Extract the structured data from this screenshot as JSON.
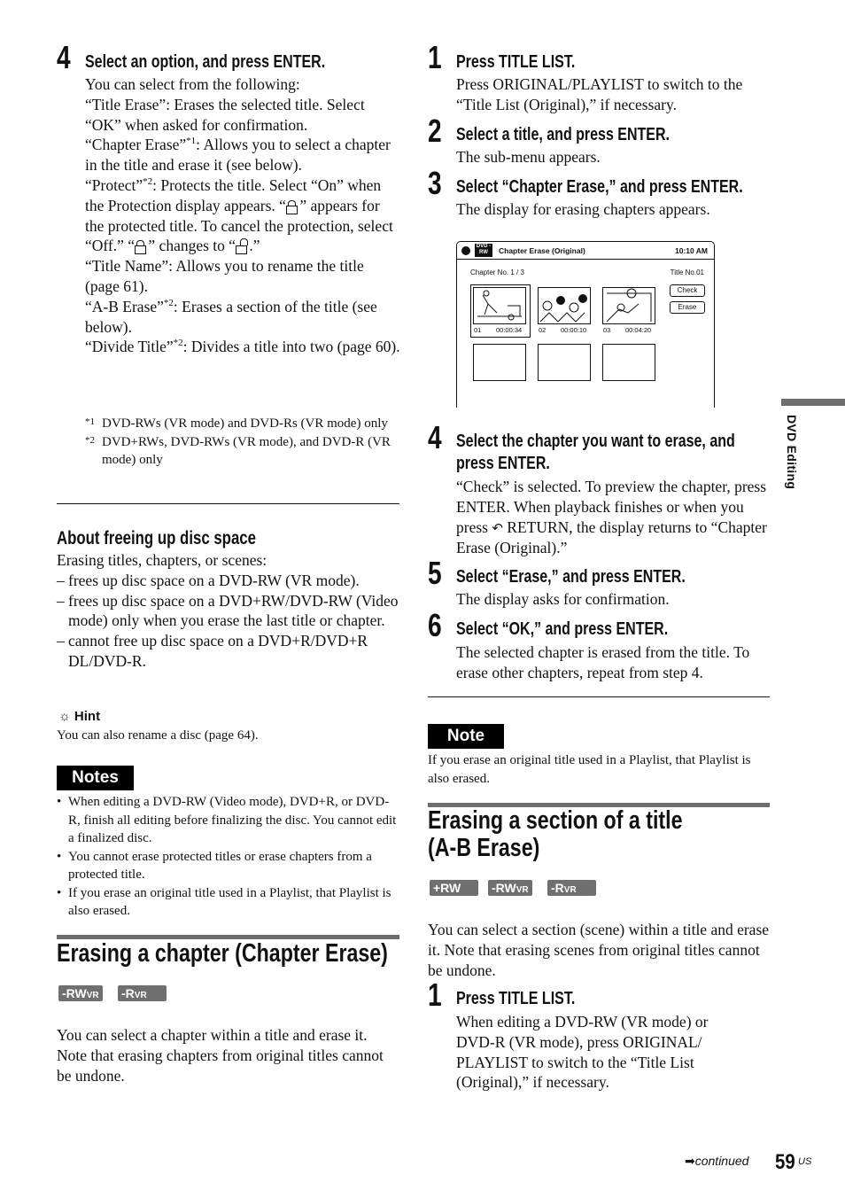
{
  "left": {
    "step4": {
      "number": "4",
      "heading": "Select an option, and press ENTER.",
      "intro": "You can select from the following:",
      "title_erase": "“Title Erase”: Erases the selected title. Select “OK” when asked for confirmation.",
      "chapter_erase": {
        "pre": "“Chapter Erase”",
        "sup": "*1",
        "post": ": Allows you to select a chapter in the title and erase it (see below)."
      },
      "protect": {
        "pre": "“Protect”",
        "sup": "*2",
        "p1": ": Protects the title. Select “On” when the Protection display appears. “",
        "p2": " ” appears for the protected title. To cancel the protection, select “Off.” “",
        "p3": " ” changes to “",
        "p4": " .”"
      },
      "title_name": "“Title Name”: Allows you to rename the title (page 61).",
      "ab_erase": {
        "pre": "“A-B Erase”",
        "sup": "*2",
        "post": ": Erases a section of the title (see below)."
      },
      "divide_title": {
        "pre": "“Divide Title”",
        "sup": "*2",
        "post": ": Divides a title into two (page 60)."
      },
      "footnotes": [
        {
          "mark": "*1",
          "text": "DVD-RWs (VR mode) and DVD-Rs (VR mode) only"
        },
        {
          "mark": "*2",
          "text": "DVD+RWs, DVD-RWs (VR mode), and DVD-R (VR mode) only"
        }
      ]
    },
    "freeing": {
      "heading": "About freeing up disc space",
      "intro": "Erasing titles, chapters, or scenes:",
      "items": [
        "frees up disc space on a DVD-RW (VR mode).",
        "frees up disc space on a DVD+RW/DVD-RW (Video mode) only when you erase the last title or chapter.",
        "cannot free up disc space on a DVD+R/DVD+R DL/DVD-R."
      ]
    },
    "hint": {
      "label": "Hint",
      "text": "You can also rename a disc (page 64)."
    },
    "notes": {
      "label": "Notes",
      "items": [
        "When editing a DVD-RW (Video mode), DVD+R, or DVD-R, finish all editing before finalizing the disc. You cannot edit a finalized disc.",
        "You cannot erase protected titles or erase chapters from a protected title.",
        "If you erase an original title used in a Playlist, that Playlist is also erased."
      ]
    },
    "section": {
      "title": "Erasing a chapter (Chapter Erase)",
      "badges": [
        {
          "main": "-RW",
          "sub": "VR"
        },
        {
          "main": "-R",
          "sub": "VR"
        }
      ],
      "text": "You can select a chapter within a title and erase it. Note that erasing chapters from original titles cannot be undone."
    }
  },
  "right": {
    "steps": [
      {
        "number": "1",
        "heading": "Press TITLE LIST.",
        "text": "Press ORIGINAL/PLAYLIST to switch to the “Title List (Original),” if necessary."
      },
      {
        "number": "2",
        "heading": "Select a title, and press ENTER.",
        "text": "The sub-menu appears."
      },
      {
        "number": "3",
        "heading": "Select “Chapter Erase,” and press ENTER.",
        "text": "The display for erasing chapters appears."
      },
      {
        "number": "4",
        "heading_line1": "Select the chapter you want to erase, and",
        "heading_line2": "press ENTER.",
        "text_pre": "“Check” is selected. To preview the chapter, press ENTER. When playback finishes or when you press ",
        "text_post": " RETURN, the display returns to “Chapter Erase (Original).”"
      },
      {
        "number": "5",
        "heading": "Select “Erase,” and press ENTER.",
        "text": "The display asks for confirmation."
      },
      {
        "number": "6",
        "heading": "Select “OK,” and press ENTER.",
        "text": "The selected chapter is erased from the title. To erase other chapters, repeat from step 4."
      }
    ],
    "screen": {
      "disc_badge": "DVD -RW",
      "title": "Chapter Erase (Original)",
      "time": "10:10 AM",
      "chapter_no": "Chapter No. 1 / 3",
      "title_no": "Title No.01",
      "chapters": [
        {
          "num": "01",
          "time": "00:00:34"
        },
        {
          "num": "02",
          "time": "00:00:10"
        },
        {
          "num": "03",
          "time": "00:04:20"
        }
      ],
      "buttons": [
        "Check",
        "Erase"
      ]
    },
    "note": {
      "label": "Note",
      "text": "If you erase an original title used in a Playlist, that Playlist is also erased."
    },
    "section": {
      "title_line1": "Erasing a section of a title",
      "title_line2": "(A-B Erase)",
      "badges": [
        {
          "main": "+RW",
          "sub": ""
        },
        {
          "main": "-RW",
          "sub": "VR"
        },
        {
          "main": "-R",
          "sub": "VR"
        }
      ],
      "text": "You can select a section (scene) within a title and erase it. Note that erasing scenes from original titles cannot be undone.",
      "step1": {
        "number": "1",
        "heading": "Press TITLE LIST.",
        "text": "When editing a DVD-RW (VR mode) or DVD-R (VR mode), press ORIGINAL/ PLAYLIST to switch to the “Title List (Original),” if necessary."
      }
    }
  },
  "side_tab": "DVD Editing",
  "footer": {
    "continued": "continued",
    "page": "59",
    "suffix": "US"
  }
}
